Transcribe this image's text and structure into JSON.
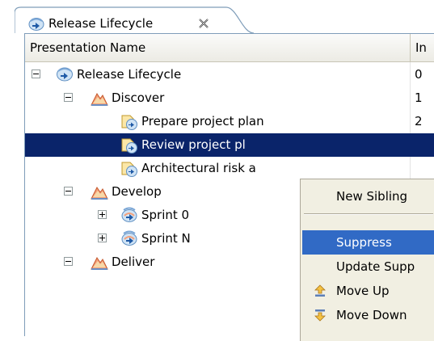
{
  "tab": {
    "title": "Release Lifecycle",
    "close_icon": "close-x-icon"
  },
  "table": {
    "columns": [
      "Presentation Name",
      "In"
    ],
    "rows": [
      {
        "label": "Release Lifecycle",
        "index": "0",
        "icon": "delivery-process-icon",
        "expander": "expanded",
        "depth": 0,
        "selected": false
      },
      {
        "label": "Discover",
        "index": "1",
        "icon": "phase-icon",
        "expander": "expanded",
        "depth": 1,
        "selected": false
      },
      {
        "label": "Prepare project plan",
        "index": "2",
        "icon": "task-descriptor-icon",
        "expander": "none",
        "depth": 2,
        "selected": false
      },
      {
        "label": "Review project pl",
        "index": "",
        "icon": "task-descriptor-icon",
        "expander": "none",
        "depth": 2,
        "selected": true
      },
      {
        "label": "Architectural risk a",
        "index": "",
        "icon": "task-descriptor-icon",
        "expander": "none",
        "depth": 2,
        "selected": false
      },
      {
        "label": "Develop",
        "index": "",
        "icon": "phase-icon",
        "expander": "expanded",
        "depth": 1,
        "selected": false
      },
      {
        "label": "Sprint 0",
        "index": "",
        "icon": "iteration-icon",
        "expander": "collapsed",
        "depth": 2,
        "selected": false
      },
      {
        "label": "Sprint N",
        "index": "",
        "icon": "iteration-icon",
        "expander": "collapsed",
        "depth": 2,
        "selected": false
      },
      {
        "label": "Deliver",
        "index": "",
        "icon": "phase-icon",
        "expander": "expanded",
        "depth": 1,
        "selected": false
      }
    ]
  },
  "context_menu": {
    "items": [
      {
        "label": "New Sibling",
        "icon": "",
        "active": false
      },
      {
        "label": "Suppress",
        "icon": "",
        "active": true
      },
      {
        "label": "Update Supp",
        "icon": "",
        "active": false
      },
      {
        "label": "Move Up",
        "icon": "move-up-icon",
        "active": false
      },
      {
        "label": "Move Down",
        "icon": "move-down-icon",
        "active": false
      }
    ]
  },
  "colors": {
    "selection": "#0a246a",
    "menu_highlight": "#316ac5",
    "menu_background": "#f1efe2",
    "phase_icon": "#f4a07a",
    "process_icon": "#3d7fbf"
  }
}
